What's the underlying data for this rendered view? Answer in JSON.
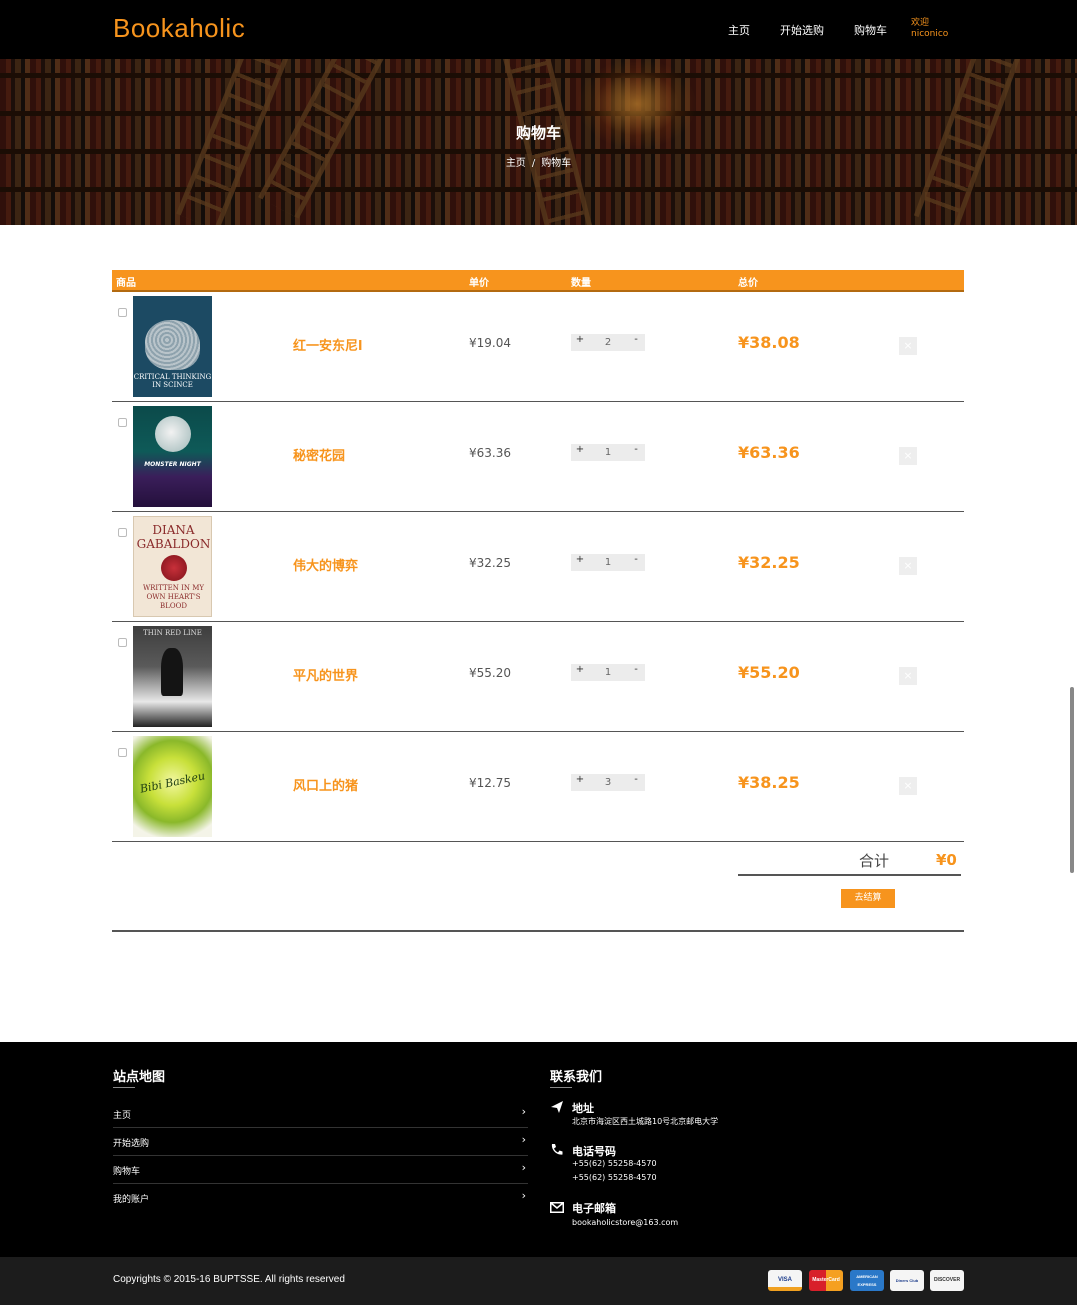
{
  "header": {
    "brand": "Bookaholic",
    "nav": [
      "主页",
      "开始选购",
      "购物车"
    ],
    "welcome_label": "欢迎",
    "username": "niconico"
  },
  "banner": {
    "title": "购物车",
    "breadcrumb": [
      "主页",
      "/",
      "购物车"
    ]
  },
  "cart": {
    "columns": [
      "商品",
      "单价",
      "数量",
      "总价"
    ],
    "items": [
      {
        "title": "红一安东尼l",
        "cover_text": "CRITICAL THINKING IN SCINCE",
        "price": "¥19.04",
        "qty": "2",
        "total": "¥38.08"
      },
      {
        "title": "秘密花园",
        "cover_text": "MONSTER NIGHT",
        "price": "¥63.36",
        "qty": "1",
        "total": "¥63.36"
      },
      {
        "title": "伟大的博弈",
        "cover_text": "DIANA GABALDON",
        "cover_subtext": "WRITTEN IN MY OWN HEART'S BLOOD",
        "price": "¥32.25",
        "qty": "1",
        "total": "¥32.25"
      },
      {
        "title": "平凡的世界",
        "cover_text": "THIN RED LINE",
        "price": "¥55.20",
        "qty": "1",
        "total": "¥55.20"
      },
      {
        "title": "风口上的猪",
        "cover_text": "Bibi Baskeu",
        "price": "¥12.75",
        "qty": "3",
        "total": "¥38.25"
      }
    ],
    "plus": "+",
    "minus": "-",
    "delete": "×",
    "sum_label": "合计",
    "sum_value": "¥0",
    "checkout_label": "去结算"
  },
  "footer": {
    "sitemap_title": "站点地图",
    "links": [
      "主页",
      "开始选购",
      "购物车",
      "我的账户"
    ],
    "contact_title": "联系我们",
    "address_title": "地址",
    "address": "北京市海淀区西土城路10号北京邮电大学",
    "phone_title": "电话号码",
    "phones": [
      "+55(62) 55258-4570",
      "+55(62) 55258-4570"
    ],
    "email_title": "电子邮箱",
    "email": "bookaholicstore@163.com",
    "copyright": "Copyrights © 2015-16 BUPTSSE. All rights reserved",
    "cards": [
      "VISA",
      "MasterCard",
      "AMERICAN EXPRESS",
      "Diners Club",
      "DISCOVER"
    ]
  },
  "colors": {
    "accent": "#f7941d",
    "header_bg": "#000000",
    "footer_bg": "#000000"
  }
}
